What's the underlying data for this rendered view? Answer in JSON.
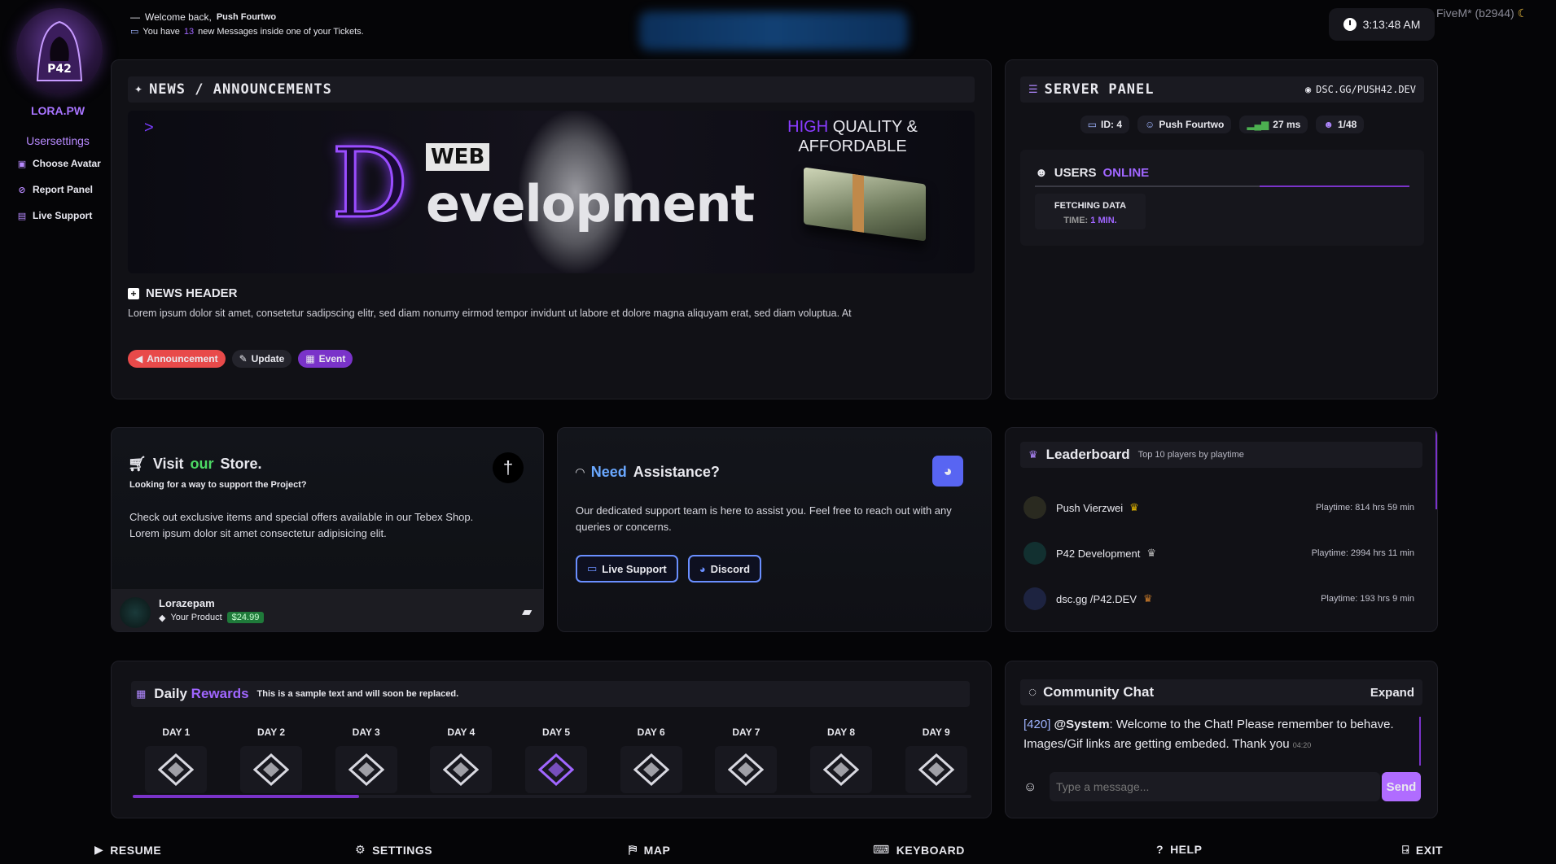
{
  "sidebar": {
    "brand": "LORA.PW",
    "usersettings": "Usersettings",
    "items": [
      {
        "label": "Choose Avatar",
        "icon": "image-icon"
      },
      {
        "label": "Report Panel",
        "icon": "ban-icon"
      },
      {
        "label": "Live Support",
        "icon": "support-icon"
      }
    ]
  },
  "top": {
    "welcome_prefix": "Welcome back,",
    "username": "Push Fourtwo",
    "messages_prefix": "You have",
    "messages_count": "13",
    "messages_suffix": "new Messages inside one of your Tickets.",
    "time": "3:13:48 AM",
    "build": "FiveM* (b2944)"
  },
  "news": {
    "title_a": "NEWS",
    "title_sep": "/",
    "title_b": "ANNOUNCEMENTS",
    "banner": {
      "web": "WEB",
      "big_d": "D",
      "word": "evelopment",
      "high": "HIGH",
      "quality": "QUALITY &",
      "affordable": "AFFORDABLE"
    },
    "header": "NEWS HEADER",
    "body": "Lorem ipsum dolor sit amet, consetetur sadipscing elitr, sed diam nonumy eirmod tempor invidunt ut labore et dolore magna aliquyam erat, sed diam voluptua. At",
    "tags": [
      {
        "label": "Announcement",
        "color": "#e84a4a"
      },
      {
        "label": "Update",
        "color": "#24242c"
      },
      {
        "label": "Event",
        "color": "#7a33c9"
      }
    ]
  },
  "server": {
    "title_a": "SERVER",
    "title_b": "PANEL",
    "discord": "DSC.GG/PUSH42.DEV",
    "id": "ID: 4",
    "name": "Push Fourtwo",
    "ping": "27 ms",
    "players": "1/48",
    "users_a": "USERS",
    "users_b": "ONLINE",
    "fetching": "FETCHING DATA",
    "time_label": "TIME:",
    "time_value": "1 MIN."
  },
  "store": {
    "title_a": "Visit",
    "title_b": "our",
    "title_c": "Store.",
    "subtitle": "Looking for a way to support the Project?",
    "body1": "Check out exclusive items and special offers available in our Tebex Shop.",
    "body2": "Lorem ipsum dolor sit amet consectetur adipisicing elit.",
    "product_user": "Lorazepam",
    "product_label": "Your Product",
    "price": "$24.99"
  },
  "support": {
    "title_a": "Need",
    "title_b": "Assistance?",
    "body": "Our dedicated support team is here to assist you. Feel free to reach out with any queries or concerns.",
    "btn_live": "Live Support",
    "btn_discord": "Discord"
  },
  "leaderboard": {
    "title": "Leaderboard",
    "subtitle": "Top 10 players by playtime",
    "rows": [
      {
        "name": "Push Vierzwei",
        "playtime": "Playtime: 814 hrs 59 min",
        "trophy": "#e0b400"
      },
      {
        "name": "P42 Development",
        "playtime": "Playtime: 2994 hrs 11 min",
        "trophy": "#b8b8b8"
      },
      {
        "name": "dsc.gg /P42.DEV",
        "playtime": "Playtime: 193 hrs 9 min",
        "trophy": "#c87a2a"
      }
    ]
  },
  "rewards": {
    "title_a": "Daily",
    "title_b": "Rewards",
    "subtitle": "This is a sample text and will soon be replaced.",
    "days": [
      "DAY 1",
      "DAY 2",
      "DAY 3",
      "DAY 4",
      "DAY 5",
      "DAY 6",
      "DAY 7",
      "DAY 8",
      "DAY 9"
    ],
    "active_index": 4,
    "progress": 0.27
  },
  "chat": {
    "title": "Community Chat",
    "expand": "Expand",
    "msg_id": "[420]",
    "msg_user": "@System",
    "msg_text": ": Welcome to the Chat! Please remember to behave. Images/Gif links are getting embeded. Thank you",
    "msg_time": "04:20",
    "placeholder": "Type a message...",
    "send": "Send"
  },
  "bottom": {
    "items": [
      {
        "label": "RESUME",
        "icon": "play-icon"
      },
      {
        "label": "SETTINGS",
        "icon": "gear-icon"
      },
      {
        "label": "MAP",
        "icon": "map-icon"
      },
      {
        "label": "KEYBOARD",
        "icon": "keyboard-icon"
      },
      {
        "label": "HELP",
        "icon": "help-icon"
      },
      {
        "label": "EXIT",
        "icon": "exit-icon"
      }
    ]
  },
  "colors": {
    "accent": "#a066ff",
    "blue": "#6a8fff",
    "send": "#b06cff",
    "price": "#1f7a3a"
  }
}
